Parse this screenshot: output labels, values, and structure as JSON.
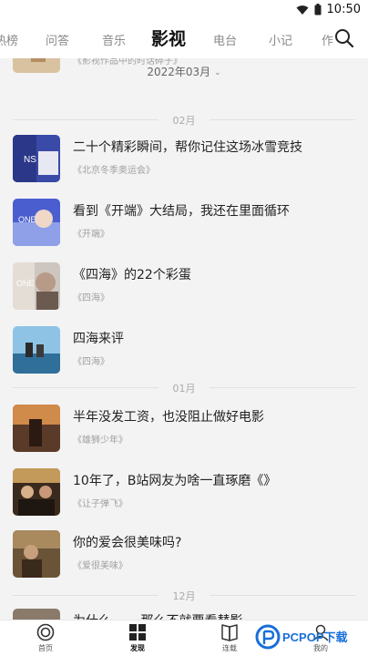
{
  "status_bar": {
    "time": "10:50"
  },
  "tabs": [
    {
      "label": "热榜"
    },
    {
      "label": "问答"
    },
    {
      "label": "音乐"
    },
    {
      "label": "影视"
    },
    {
      "label": "电台"
    },
    {
      "label": "小记"
    },
    {
      "label": "作"
    }
  ],
  "active_tab": "影视",
  "month_selector": {
    "label": "2022年03月"
  },
  "top_partial_item": {
    "tag": "《影视作品中的时话碎子》"
  },
  "sections": [
    {
      "label": "02月",
      "items": [
        {
          "title": "二十个精彩瞬间，帮你记住这场冰雪竞技",
          "tag": "《北京冬季奥运会》"
        },
        {
          "title": "看到《开端》大结局，我还在里面循环",
          "tag": "《开端》"
        },
        {
          "title": "《四海》的22个彩蛋",
          "tag": "《四海》"
        },
        {
          "title": "四海来评",
          "tag": "《四海》"
        }
      ]
    },
    {
      "label": "01月",
      "items": [
        {
          "title": "半年没发工资，也没阻止做好电影",
          "tag": "《雄狮少年》"
        },
        {
          "title": "10年了，B站网友为啥一直琢磨《》",
          "tag": "《让子弹飞》"
        },
        {
          "title": "你的爱会很美味吗?",
          "tag": "《爱很美味》"
        }
      ]
    },
    {
      "label": "12月",
      "items": [
        {
          "title": "为什么…… 那么不就要看替影…",
          "tag": ""
        }
      ]
    }
  ],
  "bottom_nav": [
    {
      "label": "首页",
      "icon": "home-circle-icon"
    },
    {
      "label": "发现",
      "icon": "grid-icon"
    },
    {
      "label": "连载",
      "icon": "book-icon"
    },
    {
      "label": "我的",
      "icon": "person-icon"
    }
  ],
  "watermark": {
    "text": "PCPOP下载"
  }
}
